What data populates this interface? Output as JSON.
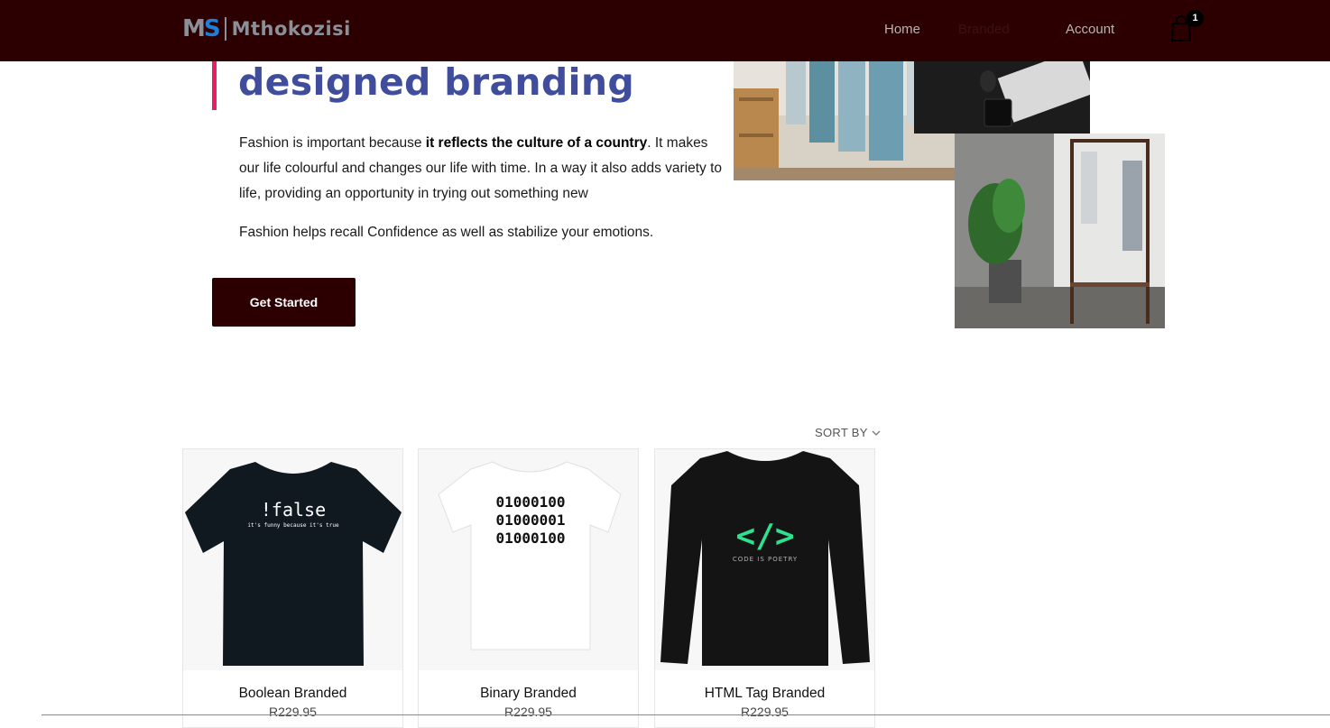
{
  "nav": {
    "brand": "Mthokozisi",
    "logo_letters": "MS",
    "links": [
      "Home",
      "Branded",
      "Account"
    ],
    "cart_count": "1"
  },
  "hero": {
    "title": "designed branding",
    "p1_a": "Fashion is important because ",
    "p1_bold": "it reflects the culture of a country",
    "p1_b": ". It makes our life colourful and changes our life with time. In a way it also adds variety to life, providing an opportunity in trying out something new",
    "p2": "Fashion helps recall Confidence as well as stabilize your emotions.",
    "cta": "Get Started"
  },
  "products": {
    "sort_label": "SORT BY",
    "items": [
      {
        "name": "Boolean Branded",
        "price": "R229.95",
        "print": "!false",
        "subprint": "it's funny because it's true"
      },
      {
        "name": "Binary Branded",
        "price": "R229.95",
        "print_lines": [
          "01000100",
          "01000001",
          "01000100"
        ]
      },
      {
        "name": "HTML Tag Branded",
        "price": "R229.95",
        "print": "</>",
        "subprint": "CODE IS POETRY"
      }
    ]
  }
}
